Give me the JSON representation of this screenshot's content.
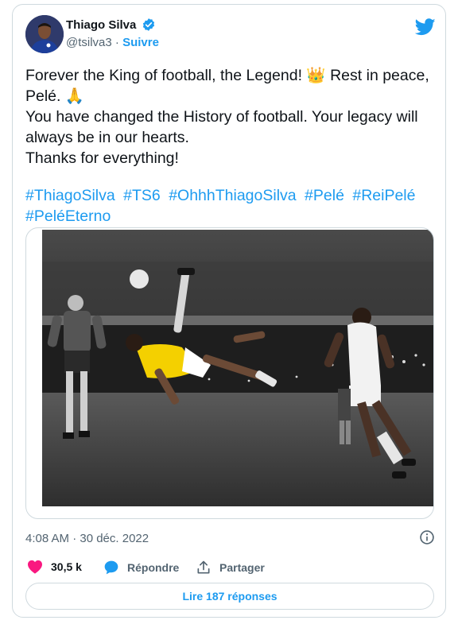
{
  "author": {
    "name": "Thiago Silva",
    "handle": "@tsilva3",
    "separator": "·",
    "follow_label": "Suivre"
  },
  "tweet": {
    "text": "Forever the King of football, the Legend! 👑 Rest in peace, Pelé. 🙏\nYou have changed the History of football. Your legacy will always be in our hearts.\nThanks for everything!",
    "hashtags": [
      "#ThiagoSilva",
      "#TS6",
      "#OhhhThiagoSilva",
      "#Pelé",
      "#ReiPelé",
      "#PeléEterno"
    ]
  },
  "meta": {
    "timestamp": "4:08 AM · 30 déc. 2022"
  },
  "actions": {
    "likes": "30,5 k",
    "reply_label": "Répondre",
    "share_label": "Partager"
  },
  "read_replies_label": "Lire 187 réponses",
  "icons": [
    "verified-badge-icon",
    "twitter-bird-icon",
    "info-icon",
    "heart-icon",
    "reply-bubble-icon",
    "share-icon"
  ],
  "colors": {
    "accent": "#1d9bf0",
    "like": "#f91880",
    "text": "#0f1419",
    "muted": "#536471",
    "border": "#cfd9de",
    "jersey": "#f4d000"
  }
}
